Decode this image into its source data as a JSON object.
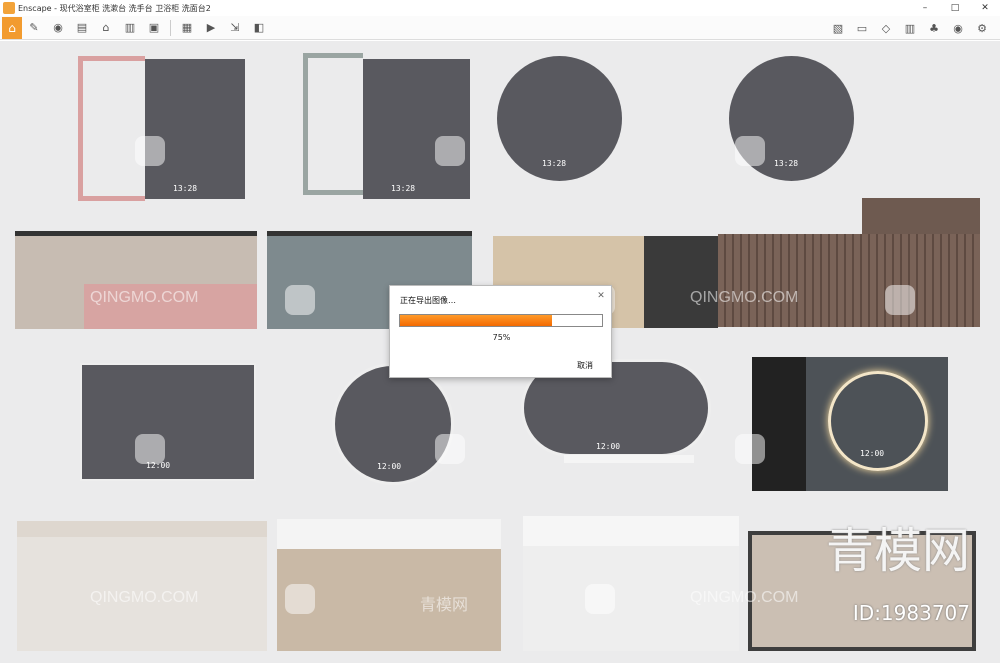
{
  "window": {
    "title": "Enscape - 现代浴室柜 洗漱台 洗手台 卫浴柜 洗面台2",
    "minimize": "–",
    "maximize": "□",
    "close": "✕"
  },
  "toolbar": {
    "left_icons": [
      "home-icon",
      "paint-icon",
      "eye-icon",
      "bim-icon",
      "house-icon",
      "chart-icon",
      "clapper-icon",
      "image-icon",
      "video-icon",
      "export-icon",
      "screenshot-icon"
    ],
    "right_icons": [
      "map-icon",
      "render-icon",
      "cube-icon",
      "library-icon",
      "tree-icon",
      "eye-icon",
      "settings-icon"
    ]
  },
  "scene": {
    "clocks": [
      "13:28",
      "13:28",
      "13:28",
      "13:28",
      "12:00",
      "12:00",
      "12:00",
      "12:00"
    ]
  },
  "watermarks": {
    "text": "QINGMO.COM",
    "cn": "青模网",
    "brand": "青模网",
    "id": "ID:1983707"
  },
  "dialog": {
    "title": "正在导出图像…",
    "progress_percent": 75,
    "progress_label": "75%",
    "cancel_label": "取消"
  }
}
